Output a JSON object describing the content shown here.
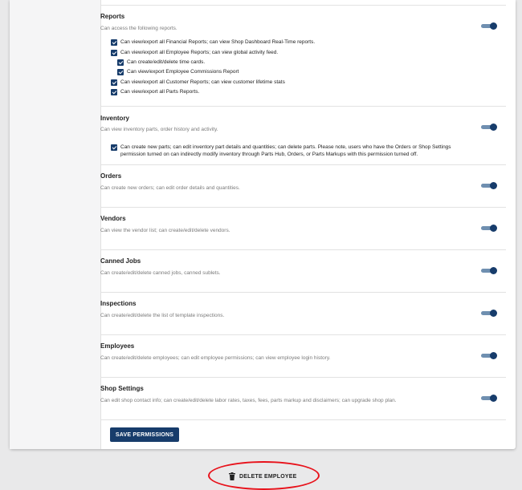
{
  "sections": [
    {
      "title": "Reports",
      "description": "Can access the following reports.",
      "perms": [
        "Can view/export all Financial Reports; can view Shop Dashboard Real-Time reports.",
        "Can view/export all Employee Reports; can view global activity feed.",
        "Can create/edit/delete time cards.",
        "Can view/export Employee Commissions Report",
        "Can view/export all Customer Reports; can view customer lifetime stats",
        "Can view/export all Parts Reports."
      ]
    },
    {
      "title": "Inventory",
      "description": "Can view inventory parts, order history and activity.",
      "perms": [
        "Can create new parts; can edit inventory part details and quantities; can delete parts. Please note, users who have the Orders or Shop Settings permission turned on can indirectly modify inventory through Parts Hub, Orders, or Parts Markups with this permission turned off."
      ]
    },
    {
      "title": "Orders",
      "description": "Can create new orders; can edit order details and quantities."
    },
    {
      "title": "Vendors",
      "description": "Can view the vendor list; can create/edit/delete vendors."
    },
    {
      "title": "Canned Jobs",
      "description": "Can create/edit/delete canned jobs, canned sublets."
    },
    {
      "title": "Inspections",
      "description": "Can create/edit/delete the list of template inspections."
    },
    {
      "title": "Employees",
      "description": "Can create/edit/delete employees; can edit employee permissions; can view employee login history."
    },
    {
      "title": "Shop Settings",
      "description": "Can edit shop contact info; can create/edit/delete labor rates, taxes, fees, parts markup and disclaimers; can upgrade shop plan."
    }
  ],
  "save_button": "SAVE PERMISSIONS",
  "delete_button": "DELETE EMPLOYEE",
  "colors": {
    "accent": "#173c6b",
    "toggle_track": "#6f8fb0",
    "highlight": "#e8121b"
  },
  "icons": {
    "delete": "trash-icon",
    "checkbox": "checked-checkbox-icon"
  }
}
